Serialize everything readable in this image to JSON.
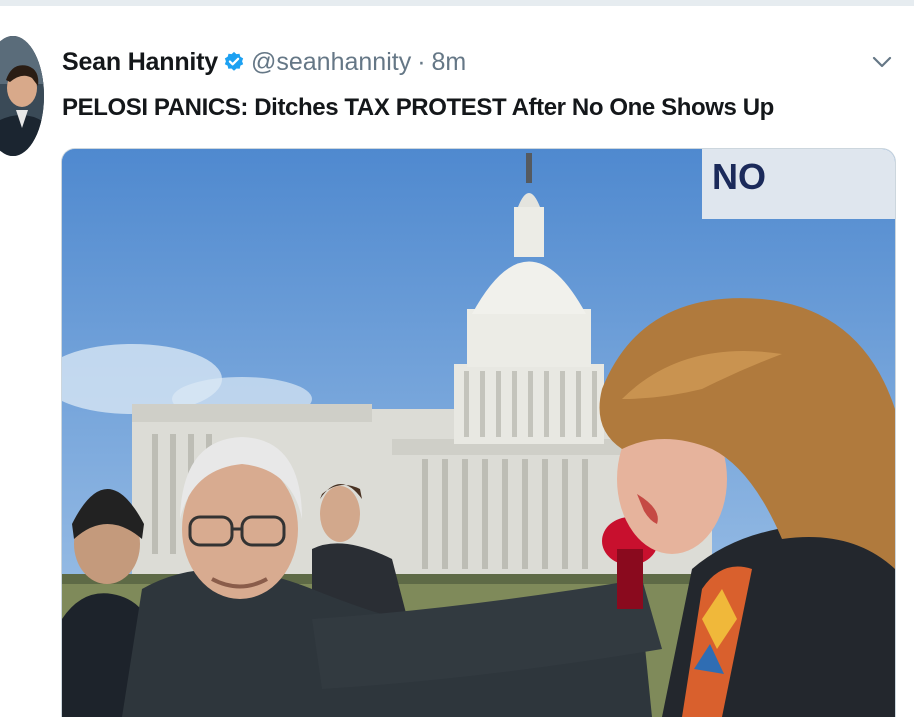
{
  "tweet": {
    "display_name": "Sean Hannity",
    "handle": "@seanhannity",
    "separator": "·",
    "timestamp": "8m",
    "text": "PELOSI PANICS: Ditches TAX PROTEST After No One Shows Up",
    "verified": true
  },
  "icons": {
    "verified": "verified-badge-icon",
    "menu": "chevron-down-icon"
  },
  "colors": {
    "name": "#14171a",
    "meta": "#657786",
    "verified": "#1da1f2",
    "border": "#ccd6dd"
  }
}
